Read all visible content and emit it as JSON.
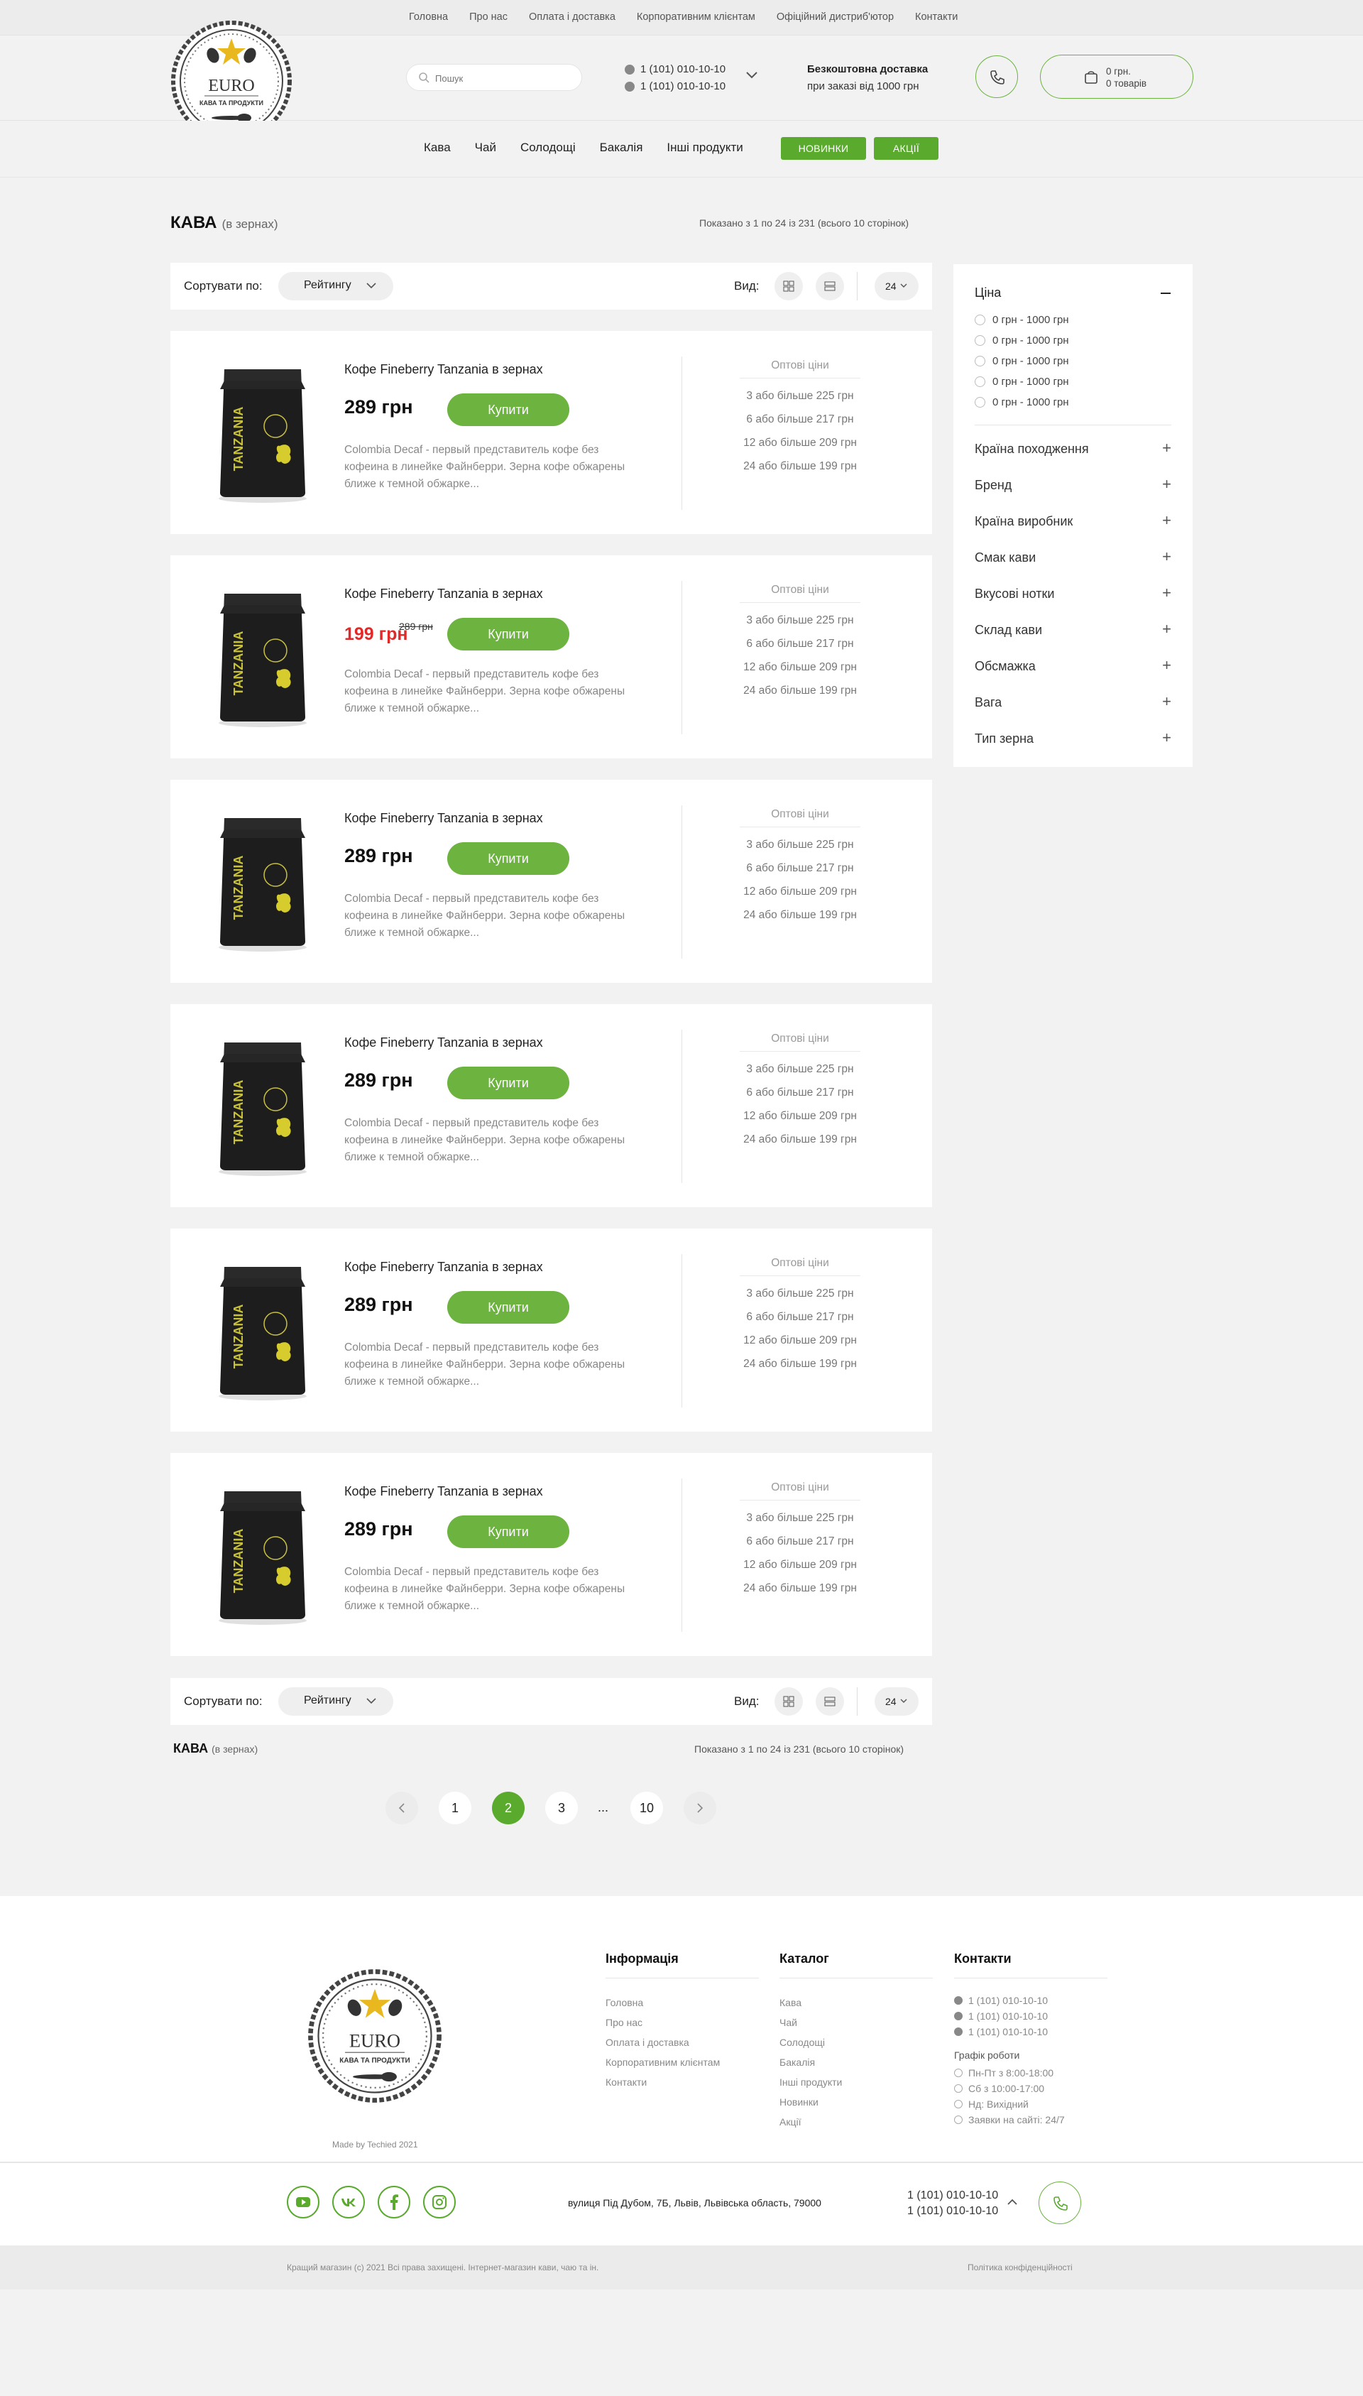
{
  "topbar": {
    "links": [
      "Головна",
      "Про нас",
      "Оплата і доставка",
      "Корпоративним клієнтам",
      "Офіційний дистриб'ютор",
      "Контакти"
    ]
  },
  "logo": {
    "brand": "EURO",
    "tagline": "КАВА ТА ПРОДУКТИ"
  },
  "header": {
    "search_placeholder": "Пошук",
    "phones": [
      "1 (101) 010-10-10",
      "1 (101) 010-10-10"
    ],
    "delivery_title": "Безкоштовна доставка",
    "delivery_sub": "при заказі від 1000 грн",
    "cart_sum": "0 грн.",
    "cart_count": "0 товарів"
  },
  "nav": {
    "items": [
      "Кава",
      "Чай",
      "Солодощі",
      "Бакалія",
      "Інші продукти"
    ],
    "new_label": "НОВИНКИ",
    "promo_label": "АКЦІЇ"
  },
  "page": {
    "title": "КАВА",
    "subtitle": "(в зернах)",
    "shown": "Показано з 1 по 24 із 231 (всього 10 сторінок)"
  },
  "sort": {
    "label": "Сортувати по:",
    "value": "Рейтингу",
    "view_label": "Вид:",
    "per_page": "24"
  },
  "products": [
    {
      "name": "Кофе Fineberry Tanzania в зернах",
      "price": "289 грн",
      "old_price": "",
      "buy": "Купити",
      "desc": "Colombia Decaf - первый представитель кофе без кофеина в линейке Файнберри. Зерна кофе обжарены ближе к темной обжарке...",
      "bag_label": "TANZANIA"
    },
    {
      "name": "Кофе Fineberry Tanzania в зернах",
      "price": "199 грн",
      "old_price": "289 грн",
      "buy": "Купити",
      "desc": "Colombia Decaf - первый представитель кофе без кофеина в линейке Файнберри. Зерна кофе обжарены ближе к темной обжарке...",
      "bag_label": "TANZANIA"
    },
    {
      "name": "Кофе Fineberry Tanzania в зернах",
      "price": "289 грн",
      "old_price": "",
      "buy": "Купити",
      "desc": "Colombia Decaf - первый представитель кофе без кофеина в линейке Файнберри. Зерна кофе обжарены ближе к темной обжарке...",
      "bag_label": "TANZANIA"
    },
    {
      "name": "Кофе Fineberry Tanzania в зернах",
      "price": "289 грн",
      "old_price": "",
      "buy": "Купити",
      "desc": "Colombia Decaf - первый представитель кофе без кофеина в линейке Файнберри. Зерна кофе обжарены ближе к темной обжарке...",
      "bag_label": "TANZANIA"
    },
    {
      "name": "Кофе Fineberry Tanzania в зернах",
      "price": "289 грн",
      "old_price": "",
      "buy": "Купити",
      "desc": "Colombia Decaf - первый представитель кофе без кофеина в линейке Файнберри. Зерна кофе обжарены ближе к темной обжарке...",
      "bag_label": "TANZANIA"
    },
    {
      "name": "Кофе Fineberry Tanzania в зернах",
      "price": "289 грн",
      "old_price": "",
      "buy": "Купити",
      "desc": "Colombia Decaf - первый представитель кофе без кофеина в линейке Файнберри. Зерна кофе обжарены ближе к темной обжарке...",
      "bag_label": "TANZANIA"
    }
  ],
  "wholesale": {
    "title": "Оптові ціни",
    "rows": [
      "3 або більше 225 грн",
      "6 або більше 217 грн",
      "12 або більше 209 грн",
      "24 або більше 199 грн"
    ]
  },
  "filters": {
    "price_title": "Ціна",
    "price_options": [
      "0 грн - 1000 грн",
      "0 грн - 1000 грн",
      "0 грн - 1000 грн",
      "0 грн - 1000 грн",
      "0 грн - 1000 грн"
    ],
    "groups": [
      "Країна походження",
      "Бренд",
      "Країна виробник",
      "Смак кави",
      "Вкусові нотки",
      "Склад кави",
      "Обсмажка",
      "Вага",
      "Тип зерна"
    ]
  },
  "bottom": {
    "title": "КАВА",
    "subtitle": "(в зернах)",
    "shown": "Показано з 1 по 24 із 231 (всього 10 сторінок)"
  },
  "pagination": {
    "pages": [
      "1",
      "2",
      "3",
      "10"
    ],
    "current": "2",
    "dots": "..."
  },
  "footer": {
    "made_by": "Made by Techied 2021",
    "info_title": "Інформація",
    "info_items": [
      "Головна",
      "Про нас",
      "Оплата і доставка",
      "Корпоративним клієнтам",
      "Контакти"
    ],
    "catalog_title": "Каталог",
    "catalog_items": [
      "Кава",
      "Чай",
      "Солодощі",
      "Бакалія",
      "Інші продукти",
      "Новинки",
      "Акції"
    ],
    "contacts_title": "Контакти",
    "contact_phones": [
      "1 (101) 010-10-10",
      "1 (101) 010-10-10",
      "1 (101) 010-10-10"
    ],
    "schedule_title": "Графік роботи",
    "schedule": [
      "Пн-Пт з 8:00-18:00",
      "Сб з 10:00-17:00",
      "Нд: Вихідний",
      "Заявки на сайті: 24/7"
    ],
    "address": "вулиця Під Дубом, 7Б, Львів, Львівська область, 79000",
    "phones": [
      "1 (101) 010-10-10",
      "1 (101) 010-10-10"
    ],
    "copyright": "Кращий магазин (c) 2021 Всі права захищені. Інтернет-магазин кави, чаю та ін.",
    "privacy": "Політика конфіденційності"
  },
  "colors": {
    "accent": "#6cb33f",
    "accent_dark": "#5aaa2e",
    "sale": "#e02a2a"
  }
}
